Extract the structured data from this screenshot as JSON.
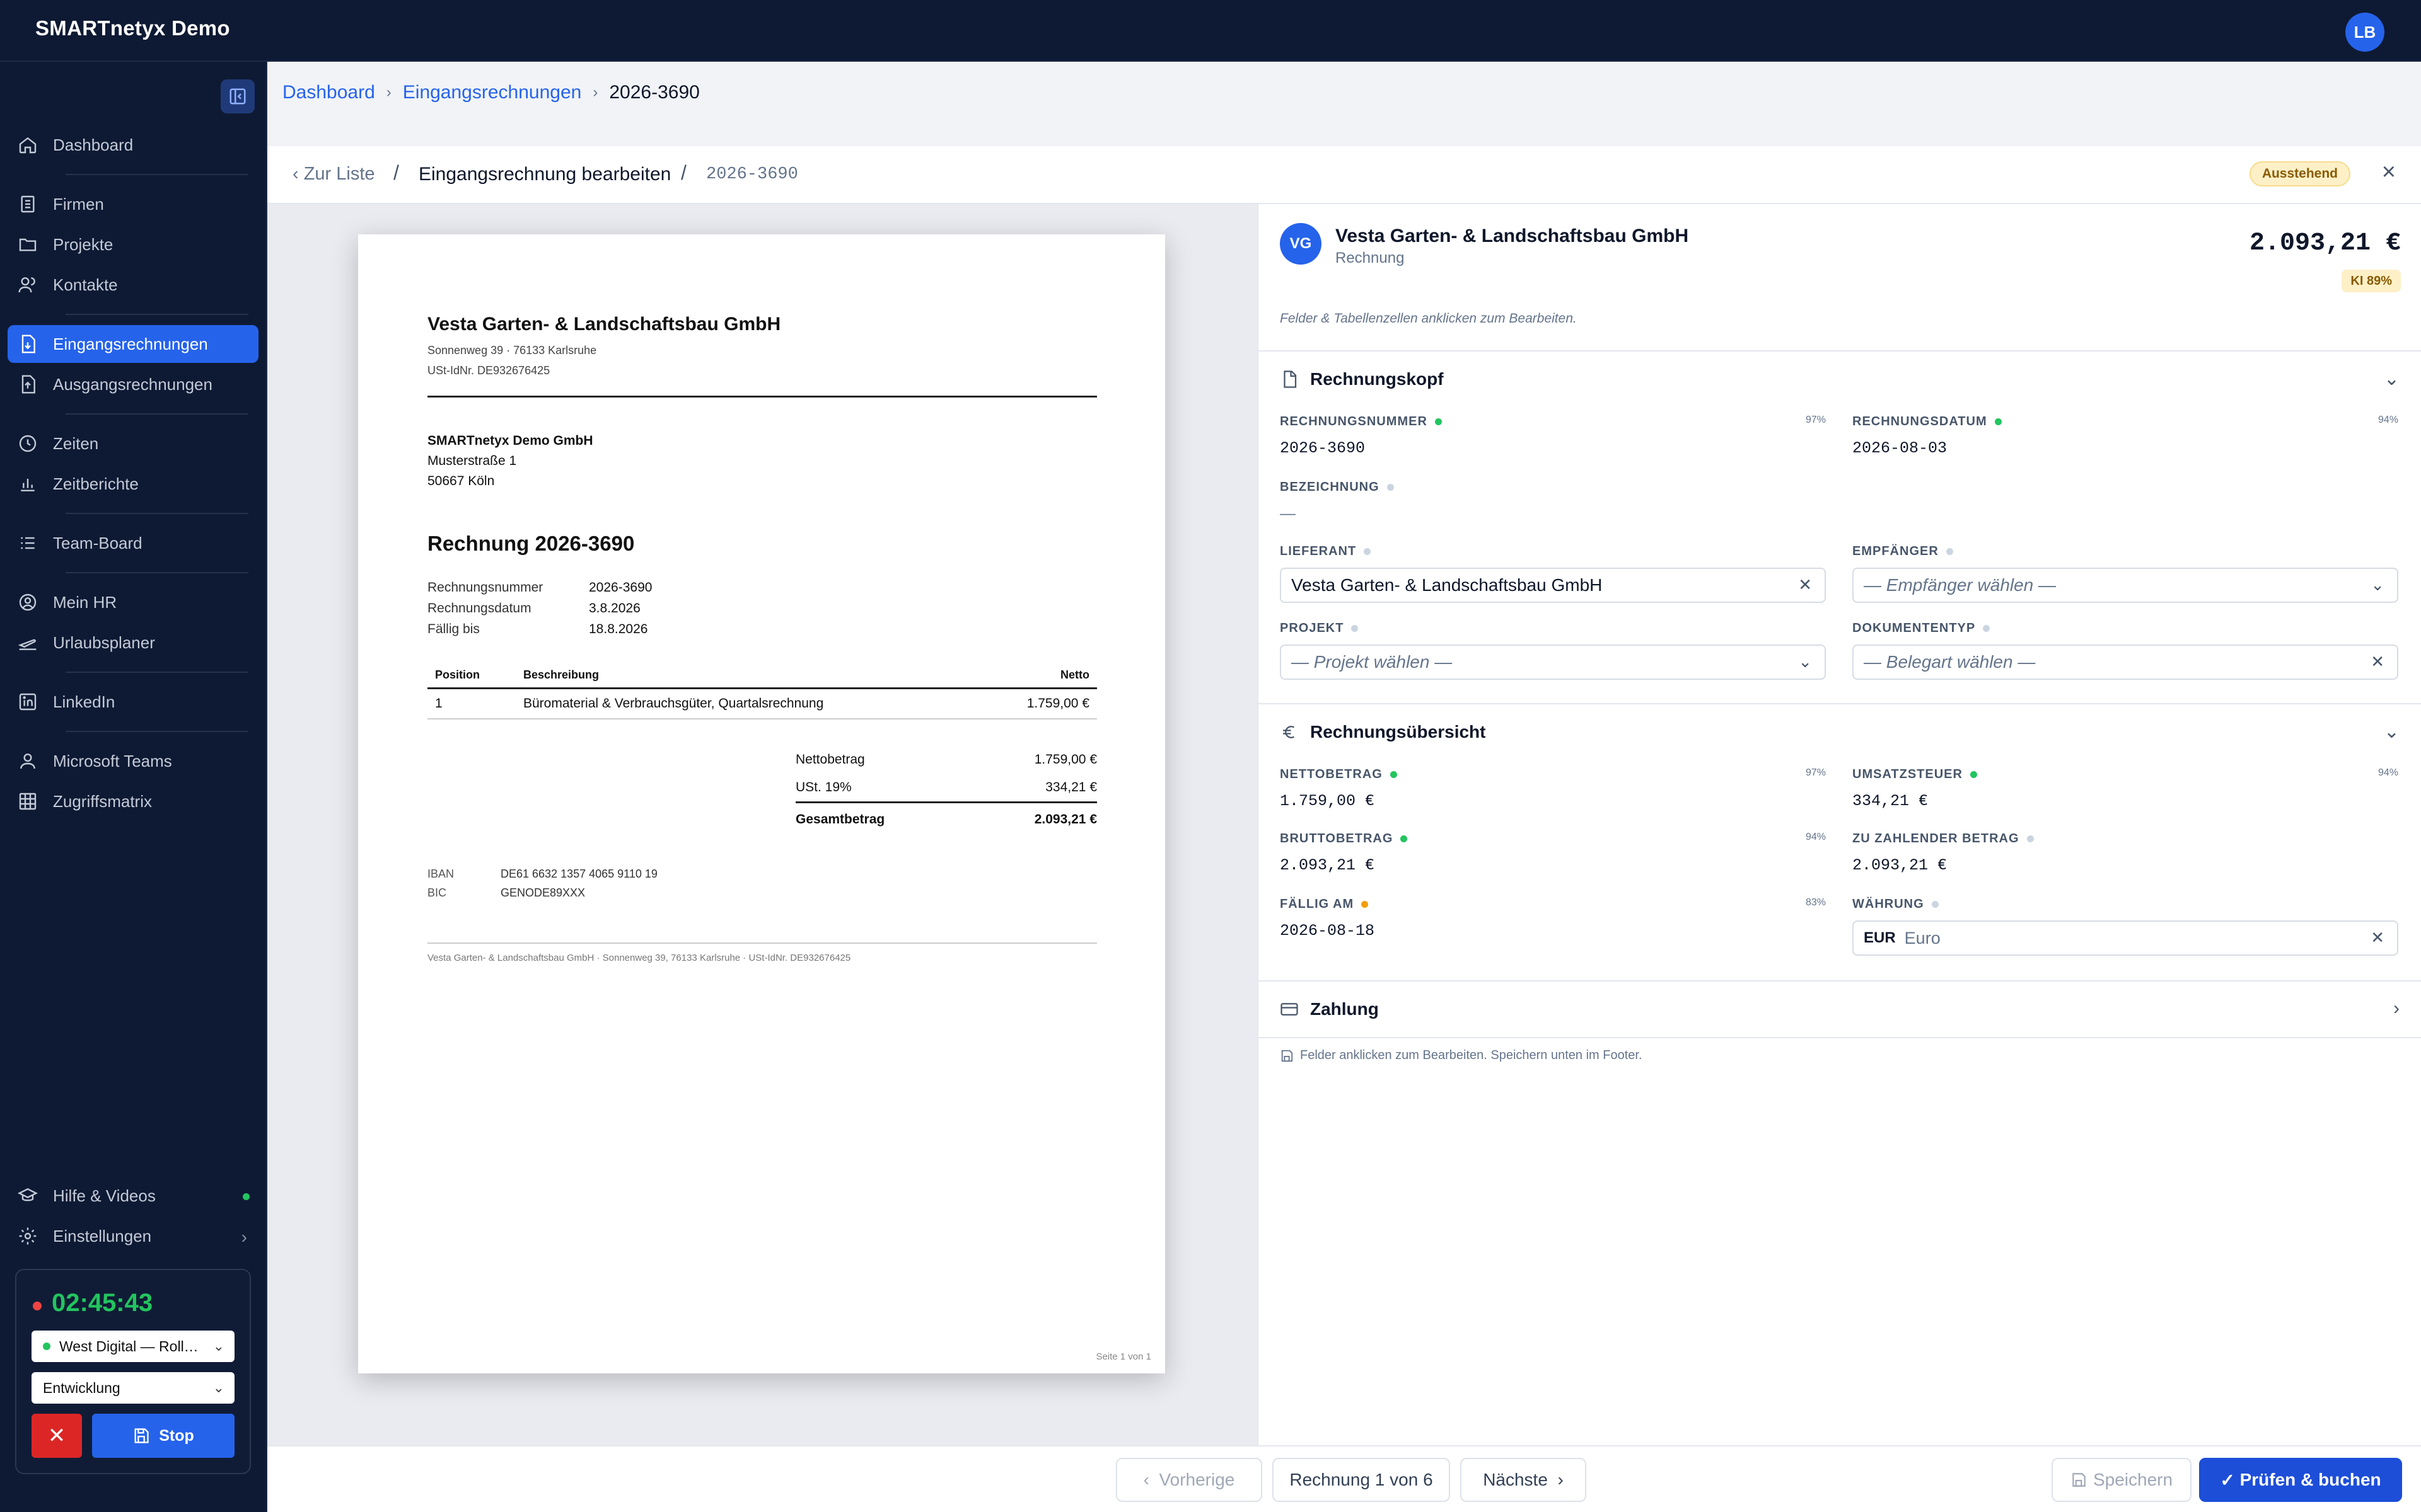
{
  "app": {
    "title": "SMARTnetyx Demo",
    "user_initials": "LB"
  },
  "sidebar": {
    "items": [
      {
        "label": "Dashboard"
      },
      {
        "label": "Firmen"
      },
      {
        "label": "Projekte"
      },
      {
        "label": "Kontakte"
      },
      {
        "label": "Eingangsrechnungen",
        "active": true
      },
      {
        "label": "Ausgangsrechnungen"
      },
      {
        "label": "Zeiten"
      },
      {
        "label": "Zeitberichte"
      },
      {
        "label": "Team-Board"
      },
      {
        "label": "Mein HR"
      },
      {
        "label": "Urlaubsplaner"
      },
      {
        "label": "LinkedIn"
      },
      {
        "label": "Microsoft Teams"
      },
      {
        "label": "Zugriffsmatrix"
      }
    ],
    "bottom": [
      {
        "label": "Hilfe & Videos"
      },
      {
        "label": "Einstellungen"
      }
    ],
    "timer": {
      "time": "02:45:43",
      "project": "West Digital — Roll…",
      "activity": "Entwicklung",
      "stop_label": "Stop"
    }
  },
  "breadcrumb": [
    "Dashboard",
    "Eingangsrechnungen",
    "2026-3690"
  ],
  "subbar": {
    "back_label": "Zur Liste",
    "title": "Eingangsrechnung bearbeiten",
    "id": "2026-3690",
    "status": "Ausstehend"
  },
  "document": {
    "supplier": "Vesta Garten- & Landschaftsbau GmbH",
    "supplier_address": "Sonnenweg 39 · 76133 Karlsruhe",
    "supplier_vat": "USt-IdNr. DE932676425",
    "recipient": {
      "name": "SMARTnetyx Demo GmbH",
      "street": "Musterstraße 1",
      "city": "50667 Köln"
    },
    "title": "Rechnung 2026-3690",
    "meta": [
      {
        "k": "Rechnungsnummer",
        "v": "2026-3690"
      },
      {
        "k": "Rechnungsdatum",
        "v": "3.8.2026"
      },
      {
        "k": "Fällig bis",
        "v": "18.8.2026"
      }
    ],
    "table_headers": [
      "Position",
      "Beschreibung",
      "Netto"
    ],
    "rows": [
      {
        "pos": "1",
        "desc": "Büromaterial & Verbrauchsgüter, Quartalsrechnung",
        "net": "1.759,00 €"
      }
    ],
    "totals": [
      {
        "k": "Nettobetrag",
        "v": "1.759,00 €"
      },
      {
        "k": "USt. 19%",
        "v": "334,21 €"
      },
      {
        "k": "Gesamtbetrag",
        "v": "2.093,21 €"
      }
    ],
    "iban_label": "IBAN",
    "iban": "DE61 6632 1357 4065 9110 19",
    "bic_label": "BIC",
    "bic": "GENODE89XXX",
    "footer": "Vesta Garten- & Landschaftsbau GmbH · Sonnenweg 39, 76133 Karlsruhe · USt-IdNr. DE932676425",
    "page": "Seite 1 von 1"
  },
  "panel": {
    "avatar": "VG",
    "supplier": "Vesta Garten- & Landschaftsbau GmbH",
    "type": "Rechnung",
    "total": "2.093,21 €",
    "ki": "KI 89%",
    "hint": "Felder & Tabellenzellen anklicken zum Bearbeiten.",
    "sec1": {
      "title": "Rechnungskopf",
      "invoice_no": {
        "label": "RECHNUNGSNUMMER",
        "value": "2026-3690",
        "conf": "97%"
      },
      "invoice_date": {
        "label": "RECHNUNGSDATUM",
        "value": "2026-08-03",
        "conf": "94%"
      },
      "description": {
        "label": "BEZEICHNUNG",
        "value": "—"
      },
      "supplier": {
        "label": "LIEFERANT",
        "value": "Vesta Garten- & Landschaftsbau GmbH"
      },
      "recipient": {
        "label": "EMPFÄNGER",
        "placeholder": "— Empfänger wählen —"
      },
      "project": {
        "label": "PROJEKT",
        "placeholder": "— Projekt wählen —"
      },
      "doctype": {
        "label": "DOKUMENTENTYP",
        "placeholder": "— Belegart wählen —"
      }
    },
    "sec2": {
      "title": "Rechnungsübersicht",
      "net": {
        "label": "NETTOBETRAG",
        "value": "1.759,00 €",
        "conf": "97%"
      },
      "vat": {
        "label": "UMSATZSTEUER",
        "value": "334,21 €",
        "conf": "94%"
      },
      "gross": {
        "label": "BRUTTOBETRAG",
        "value": "2.093,21 €",
        "conf": "94%"
      },
      "payable": {
        "label": "ZU ZAHLENDER BETRAG",
        "value": "2.093,21 €"
      },
      "due": {
        "label": "FÄLLIG AM",
        "value": "2026-08-18",
        "conf": "83%"
      },
      "currency": {
        "label": "WÄHRUNG",
        "code": "EUR",
        "name": "Euro"
      }
    },
    "sec3": {
      "title": "Zahlung"
    },
    "footnote": "Felder anklicken zum Bearbeiten. Speichern unten im Footer."
  },
  "footer": {
    "prev": "Vorherige",
    "counter": "Rechnung 1 von 6",
    "next": "Nächste",
    "save": "Speichern",
    "submit": "Prüfen & buchen"
  },
  "colors": {
    "accent": "#2563eb",
    "sidebar_bg": "#0e1a33",
    "success": "#22c55e",
    "warning": "#f59e0b",
    "danger": "#dc2626"
  }
}
